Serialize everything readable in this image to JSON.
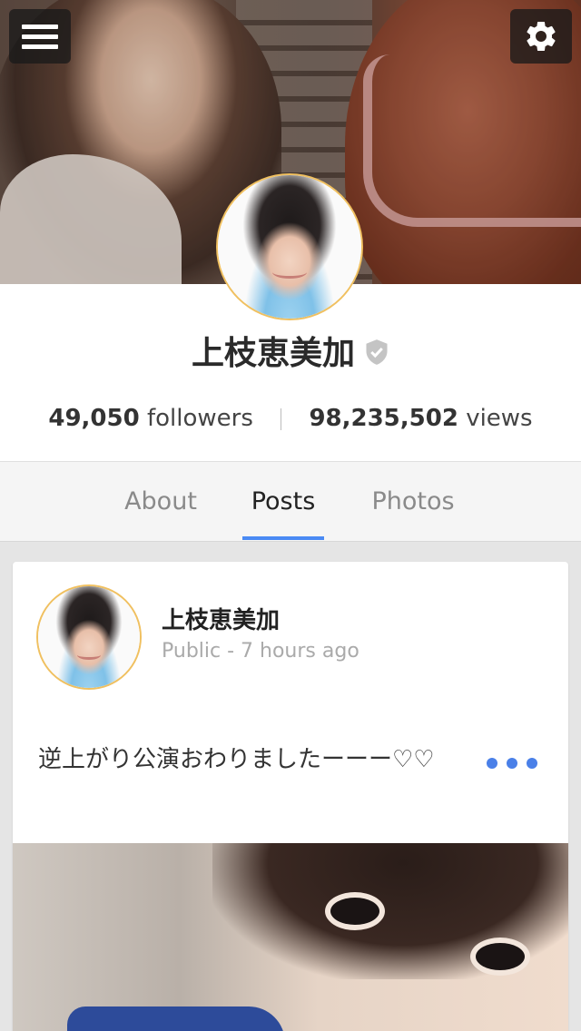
{
  "header": {
    "menu_icon": "hamburger-menu-icon",
    "settings_icon": "gear-icon"
  },
  "profile": {
    "name": "上枝恵美加",
    "verified_icon": "verified-shield-icon",
    "followers_count": "49,050",
    "followers_label": "followers",
    "views_count": "98,235,502",
    "views_label": "views"
  },
  "tabs": [
    {
      "label": "About",
      "active": false
    },
    {
      "label": "Posts",
      "active": true
    },
    {
      "label": "Photos",
      "active": false
    }
  ],
  "post": {
    "author": "上枝恵美加",
    "meta": "Public - 7 hours ago",
    "text": "逆上がり公演おわりましたーーー♡♡",
    "more_icon": "more-dots-icon"
  },
  "colors": {
    "accent": "#4a8af4",
    "more_dots": "#4a80e8",
    "avatar_ring": "#f0c060"
  }
}
